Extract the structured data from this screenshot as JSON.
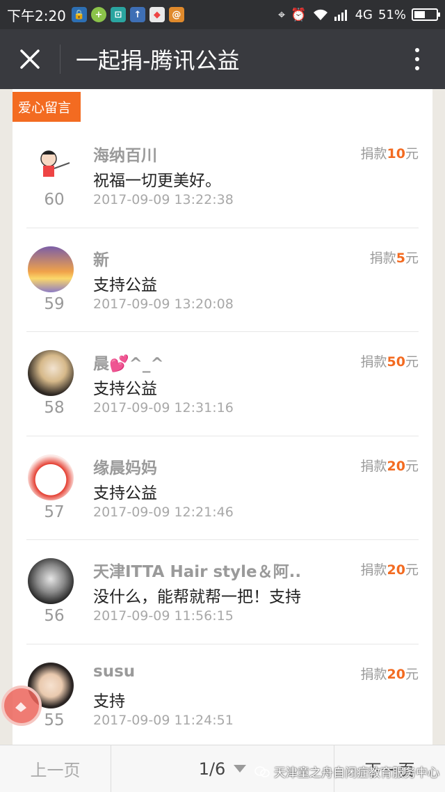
{
  "status_bar": {
    "time": "下午2:20",
    "network": "4G",
    "battery": "51%",
    "battery_level": 0.51
  },
  "header": {
    "title": "一起捐-腾讯公益"
  },
  "section_tag": "爱心留言",
  "donation_label": "捐款",
  "currency": "元",
  "messages": [
    {
      "name": "海纳百川",
      "message": "祝福一切更美好。",
      "date": "2017-09-09 13:22:38",
      "index": "60",
      "amount": "10"
    },
    {
      "name": "新",
      "message": "支持公益",
      "date": "2017-09-09 13:20:08",
      "index": "59",
      "amount": "5"
    },
    {
      "name": "晨💕^_^",
      "message": "支持公益",
      "date": "2017-09-09 12:31:16",
      "index": "58",
      "amount": "50"
    },
    {
      "name": "缘晨妈妈",
      "message": "支持公益",
      "date": "2017-09-09 12:21:46",
      "index": "57",
      "amount": "20"
    },
    {
      "name": "天津ITTA Hair style＆阿...",
      "message": "没什么，能帮就帮一把！支持",
      "date": "2017-09-09 11:56:15",
      "index": "56",
      "amount": "20"
    },
    {
      "name": "susu",
      "message": "支持",
      "date": "2017-09-09 11:24:51",
      "index": "55",
      "amount": "20"
    }
  ],
  "pager": {
    "prev": "上一页",
    "page": "1/6",
    "next": "下一页"
  },
  "watermark": "天津童之舟自闭症教育服务中心",
  "colors": {
    "accent": "#f36b21",
    "titlebar": "#393a3f",
    "statusbar": "#2f3033"
  }
}
